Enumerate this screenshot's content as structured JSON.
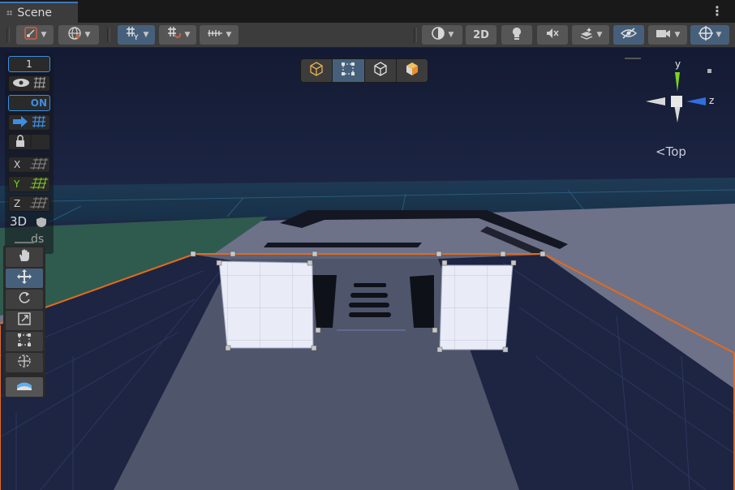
{
  "tab": {
    "title": "Scene",
    "grid_icon": "⌗",
    "menu": "⋮"
  },
  "toolbar": {
    "mode_2d": "2D",
    "dropdown": "▼"
  },
  "overlay": {
    "layer_number": "1",
    "snap_on": "ON",
    "axis_x": "X",
    "axis_y": "Y",
    "axis_z": "Z",
    "label_3d": "3D",
    "cut_label": "ds"
  },
  "gizmo": {
    "axis_y": "y",
    "axis_z": "z",
    "view_label": "Top",
    "view_chevron": "<"
  },
  "tools": [
    "hand-tool",
    "move-tool",
    "rotate-tool",
    "scale-tool",
    "rect-tool",
    "transform-tool",
    "custom-tool"
  ],
  "colors": {
    "selection_outline": "#e46a1c",
    "tab_highlight": "#3a79bb",
    "axis_x": "#d0d0d0",
    "axis_y": "#7ed321",
    "axis_z": "#2f6fe0",
    "snap_blue": "#3a8ee6"
  }
}
